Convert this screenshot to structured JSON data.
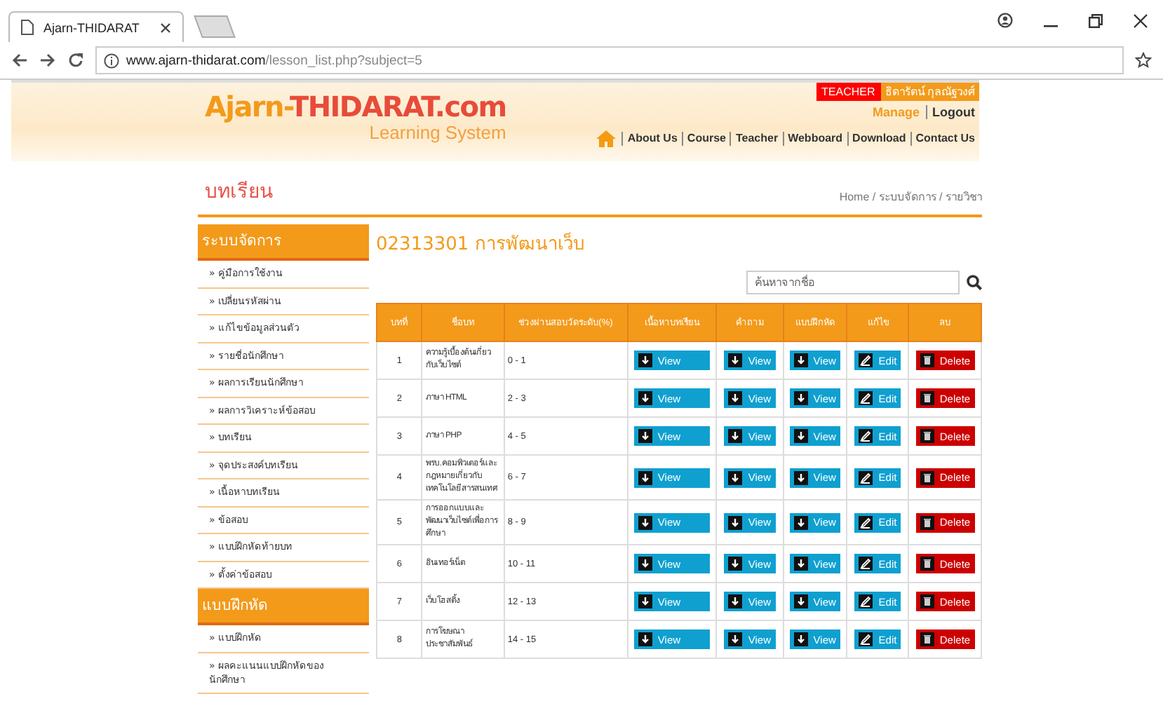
{
  "browser": {
    "tab_title": "Ajarn-THIDARAT",
    "url_domain": "www.ajarn-thidarat.com",
    "url_path": "/lesson_list.php?subject=5"
  },
  "header": {
    "logo_parts": [
      {
        "text": "Ajarn-",
        "kind": "accent"
      },
      {
        "text": "THIDARAT.com",
        "kind": "main"
      }
    ],
    "tagline": "Learning System",
    "role_badge": "TEACHER",
    "user_name": "ธิดารัตน์ กุลณัฐวงศ์",
    "account_links": [
      "Manage",
      "Logout"
    ],
    "nav": [
      "About Us",
      "Course",
      "Teacher",
      "Webboard",
      "Download",
      "Contact Us"
    ]
  },
  "page_title": "บทเรียน",
  "breadcrumb": "Home / ระบบจัดการ / รายวิชา",
  "sidebar": [
    {
      "title": "ระบบจัดการ",
      "items": [
        "» คู่มือการใช้งาน",
        "» เปลี่ยนรหัสผ่าน",
        "» แก้ไขข้อมูลส่วนตัว",
        "» รายชื่อนักศึกษา",
        "» ผลการเรียนนักศึกษา",
        "» ผลการวิเคราะห์ข้อสอบ",
        "» บทเรียน",
        "» จุดประสงค์บทเรียน",
        "» เนื้อหาบทเรียน",
        "» ข้อสอบ",
        "» แบบฝึกหัดท้ายบท",
        "» ตั้งค่าข้อสอบ"
      ]
    },
    {
      "title": "แบบฝึกหัด",
      "items": [
        "» แบบฝึกหัด",
        "» ผลคะแนนแบบฝึกหัดของนักศึกษา"
      ]
    }
  ],
  "subject_title": "02313301 การพัฒนาเว็บ",
  "search": {
    "placeholder": "ค้นหาจากชื่อ"
  },
  "table": {
    "columns": [
      "บทที่",
      "ชื่อบท",
      "ช่วงผ่านสอบวัดระดับ(%)",
      "เนื้อหาบทเรียน",
      "คำถาม",
      "แบบฝึกหัด",
      "แก้ไข",
      "ลบ"
    ],
    "rows": [
      {
        "no": "1",
        "title": "ความรู้เบื้องต้นเกี่ยวกับเว็บไซต์",
        "range": "0 - 1",
        "actions": [
          {
            "kind": "view",
            "label": "View"
          },
          {
            "kind": "view",
            "label": "View"
          },
          {
            "kind": "view",
            "label": "View"
          },
          {
            "kind": "edit",
            "label": "Edit"
          },
          {
            "kind": "delete",
            "label": "Delete"
          }
        ]
      },
      {
        "no": "2",
        "title": "ภาษา HTML",
        "range": "2 - 3",
        "actions": [
          {
            "kind": "view",
            "label": "View"
          },
          {
            "kind": "view",
            "label": "View"
          },
          {
            "kind": "view",
            "label": "View"
          },
          {
            "kind": "edit",
            "label": "Edit"
          },
          {
            "kind": "delete",
            "label": "Delete"
          }
        ]
      },
      {
        "no": "3",
        "title": "ภาษา PHP",
        "range": "4 - 5",
        "actions": [
          {
            "kind": "view",
            "label": "View"
          },
          {
            "kind": "view",
            "label": "View"
          },
          {
            "kind": "view",
            "label": "View"
          },
          {
            "kind": "edit",
            "label": "Edit"
          },
          {
            "kind": "delete",
            "label": "Delete"
          }
        ]
      },
      {
        "no": "4",
        "title": "พรบ.คอมพิวเตอร์และกฎหมายเกี่ยวกับเทคโนโลยีสารสนเทศ",
        "range": "6 - 7",
        "actions": [
          {
            "kind": "view",
            "label": "View"
          },
          {
            "kind": "view",
            "label": "View"
          },
          {
            "kind": "view",
            "label": "View"
          },
          {
            "kind": "edit",
            "label": "Edit"
          },
          {
            "kind": "delete",
            "label": "Delete"
          }
        ]
      },
      {
        "no": "5",
        "title": "การออกแบบและพัฒนาเว็บไซต์เพื่อการศึกษา",
        "range": "8 - 9",
        "actions": [
          {
            "kind": "view",
            "label": "View"
          },
          {
            "kind": "view",
            "label": "View"
          },
          {
            "kind": "view",
            "label": "View"
          },
          {
            "kind": "edit",
            "label": "Edit"
          },
          {
            "kind": "delete",
            "label": "Delete"
          }
        ]
      },
      {
        "no": "6",
        "title": "อินเทอร์เน็ต",
        "range": "10 - 11",
        "actions": [
          {
            "kind": "view",
            "label": "View"
          },
          {
            "kind": "view",
            "label": "View"
          },
          {
            "kind": "view",
            "label": "View"
          },
          {
            "kind": "edit",
            "label": "Edit"
          },
          {
            "kind": "delete",
            "label": "Delete"
          }
        ]
      },
      {
        "no": "7",
        "title": "เว็บโฮสติ้ง",
        "range": "12 - 13",
        "actions": [
          {
            "kind": "view",
            "label": "View"
          },
          {
            "kind": "view",
            "label": "View"
          },
          {
            "kind": "view",
            "label": "View"
          },
          {
            "kind": "edit",
            "label": "Edit"
          },
          {
            "kind": "delete",
            "label": "Delete"
          }
        ]
      },
      {
        "no": "8",
        "title": "การโฆษณาประชาสัมพันธ์",
        "range": "14 - 15",
        "actions": [
          {
            "kind": "view",
            "label": "View"
          },
          {
            "kind": "view",
            "label": "View"
          },
          {
            "kind": "view",
            "label": "View"
          },
          {
            "kind": "edit",
            "label": "Edit"
          },
          {
            "kind": "delete",
            "label": "Delete"
          }
        ]
      }
    ]
  }
}
